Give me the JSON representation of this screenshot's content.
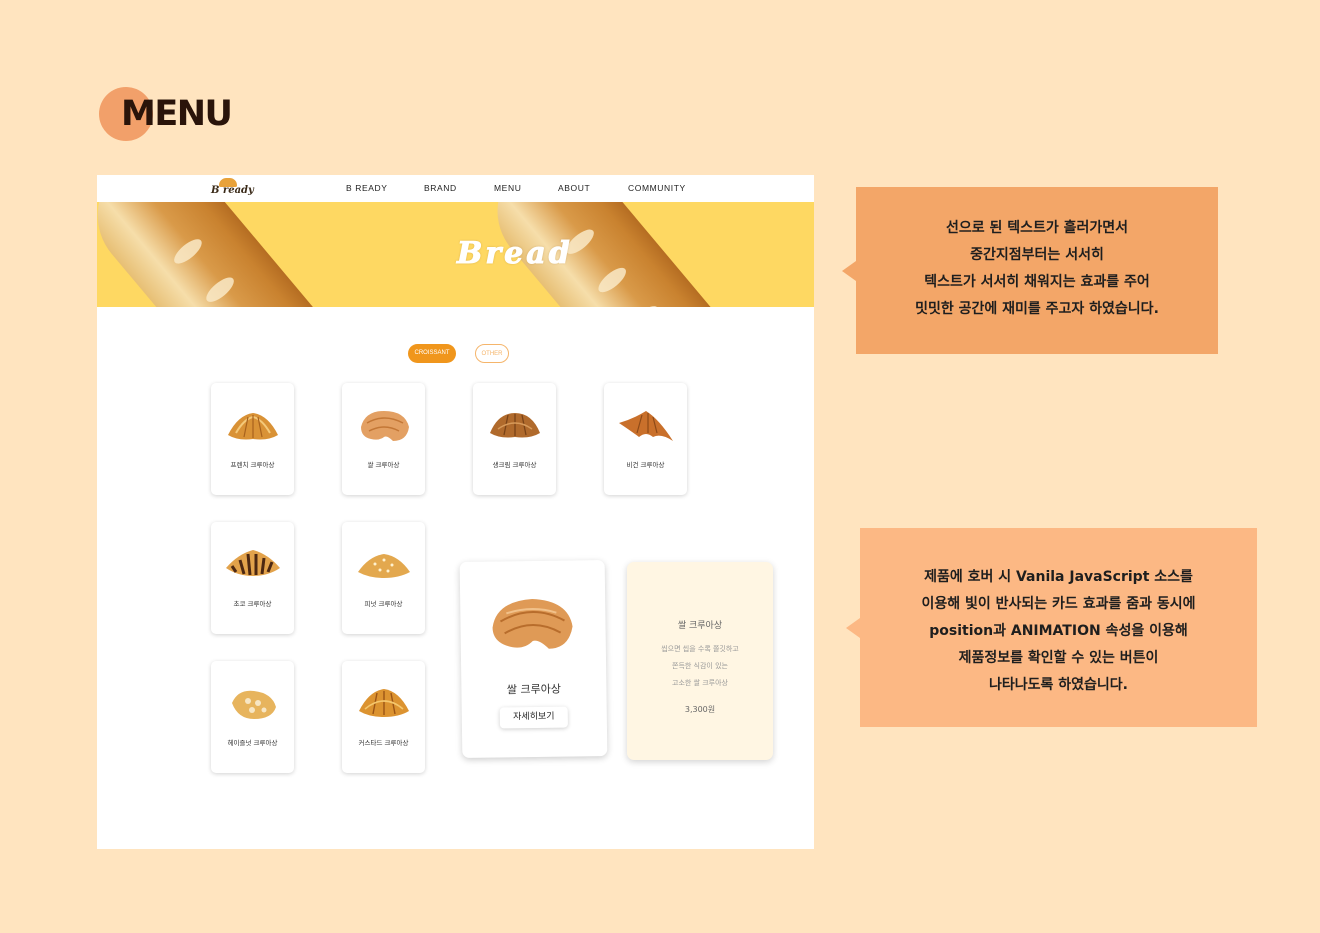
{
  "section": {
    "title": "MENU"
  },
  "site": {
    "logo_text": "B ready",
    "nav": [
      "B READY",
      "BRAND",
      "MENU",
      "ABOUT",
      "COMMUNITY"
    ],
    "banner_title": "Bread",
    "filters": {
      "active": "CROISSANT",
      "inactive": "OTHER"
    },
    "products": [
      {
        "name": "프렌치 크루아상",
        "icon": "croissant-image"
      },
      {
        "name": "쌀 크루아상",
        "icon": "croissant-image"
      },
      {
        "name": "생크림 크루아상",
        "icon": "croissant-image"
      },
      {
        "name": "비건 크루아상",
        "icon": "croissant-image"
      },
      {
        "name": "초코 크루아상",
        "icon": "chocolate-croissant-image"
      },
      {
        "name": "피넛 크루아상",
        "icon": "croissant-image"
      },
      {
        "name": "헤이즐넛 크루아상",
        "icon": "croissant-image"
      },
      {
        "name": "커스타드 크루아상",
        "icon": "croissant-image"
      }
    ],
    "featured": {
      "name": "쌀 크루아상",
      "button": "자세히보기",
      "info_title": "쌀 크루아상",
      "info_desc": [
        "씹으면 씹을 수록 쫄깃하고",
        "쫀득한 식감이 있는",
        "고소한 쌀 크루아상"
      ],
      "price": "3,300원"
    }
  },
  "callouts": {
    "first": [
      "선으로 된 텍스트가 흘러가면서",
      "중간지점부터는 서서히",
      "텍스트가 서서히 채워지는 효과를 주어",
      "밋밋한 공간에 재미를 주고자 하였습니다."
    ],
    "second": [
      "제품에 호버 시 Vanila JavaScript 소스를",
      "이용해 빛이 반사되는 카드 효과를 줌과 동시에",
      "position과 ANIMATION 속성을 이용해",
      "제품정보를 확인할 수 있는 버튼이",
      "나타나도록 하였습니다."
    ]
  },
  "colors": {
    "background": "#ffe4bf",
    "accent": "#f0961c",
    "banner": "#fed862",
    "callout_1": "#f3a668",
    "callout_2": "#fcb884"
  }
}
